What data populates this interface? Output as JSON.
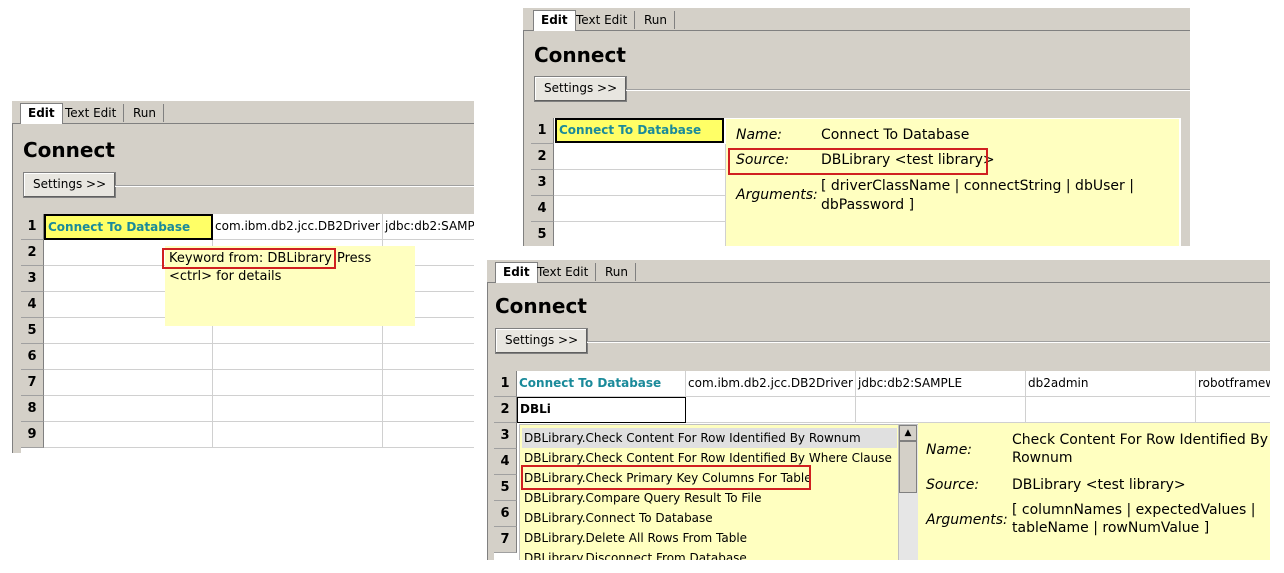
{
  "tabs": [
    "Edit",
    "Text Edit",
    "Run"
  ],
  "title": "Connect",
  "settings_label": "Settings >>",
  "row_numbers": [
    "1",
    "2",
    "3",
    "4",
    "5",
    "6",
    "7",
    "8",
    "9"
  ],
  "panel_a": {
    "row1": [
      "Connect To Database",
      "com.ibm.db2.jcc.DB2Driver",
      "jdbc:db2:SAMP"
    ],
    "tooltip_keyword": "Keyword from: DBLibrary",
    "tooltip_press": "Press",
    "tooltip_line2": "<ctrl> for details"
  },
  "panel_b": {
    "row1_keyword": "Connect To Database",
    "name_label": "Name:",
    "name_value": "Connect To Database",
    "source_label": "Source:",
    "source_value": "DBLibrary <test library>",
    "args_label": "Arguments:",
    "args_line1": "[ driverClassName | connectString | dbUser |",
    "args_line2": "dbPassword ]"
  },
  "panel_c": {
    "row1": [
      "Connect To Database",
      "com.ibm.db2.jcc.DB2Driver",
      "jdbc:db2:SAMPLE",
      "db2admin",
      "robotframew"
    ],
    "row2_input": "DBLi",
    "suggestions": [
      "DBLibrary.Check Content For Row Identified By Rownum",
      "DBLibrary.Check Content For Row Identified By Where Clause",
      "DBLibrary.Check Primary Key Columns For Table",
      "DBLibrary.Compare Query Result To File",
      "DBLibrary.Connect To Database",
      "DBLibrary.Delete All Rows From Table",
      "DBLibrary.Disconnect From Database"
    ],
    "name_label": "Name:",
    "name_line1": "Check Content For Row Identified By",
    "name_line2": "Rownum",
    "source_label": "Source:",
    "source_value": "DBLibrary <test library>",
    "args_label": "Arguments:",
    "args_line1": "[ columnNames | expectedValues |",
    "args_line2": "tableName | rowNumValue ]"
  },
  "colors": {
    "panel_bg": "#d4d0c8",
    "keyword": "#1a8a9a",
    "tooltip_bg": "#ffffc0",
    "highlight_box": "#d02020",
    "selected_cell": "#ffff66"
  }
}
